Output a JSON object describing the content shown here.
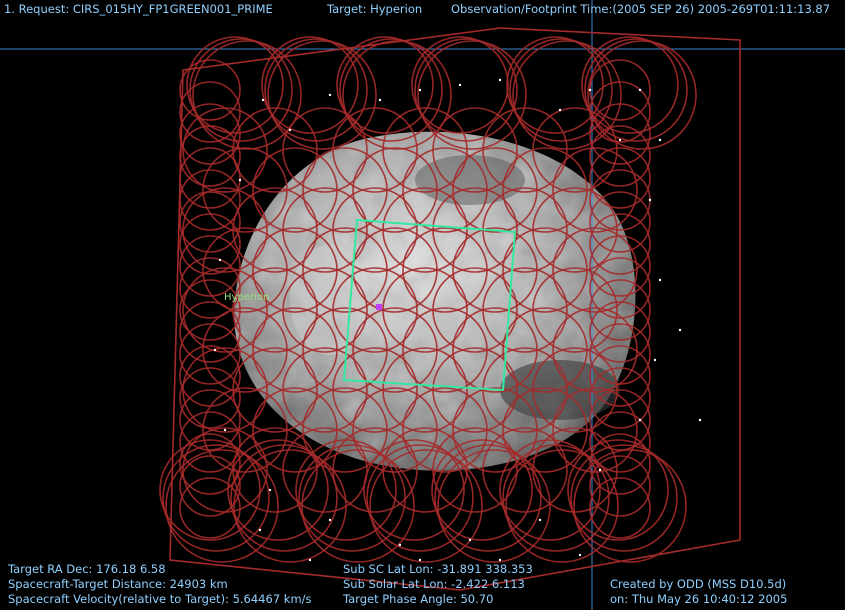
{
  "header": {
    "request": "1. Request: CIRS_015HY_FP1GREEN001_PRIME",
    "target": "Target: Hyperion",
    "observation_time": "Observation/Footprint Time:(2005 SEP 26) 2005-269T01:11:13.87"
  },
  "target_label": "Hyperion",
  "info_left": {
    "ra_dec": "Target RA Dec: 176.18   6.58",
    "distance": "Spacecraft-Target Distance:   24903 km",
    "velocity": "Spacecraft Velocity(relative to Target): 5.64467 km/s"
  },
  "info_center": {
    "sub_sc": "Sub SC Lat Lon: -31.891  338.353",
    "sub_solar": "Sub Solar Lat Lon: -2.422   6.113",
    "phase": "Target Phase Angle: 50.70"
  },
  "info_right": {
    "created_by": "Created by ODD (MSS D10.5d)",
    "created_on": "on: Thu May 26 10:40:12 2005"
  },
  "colors": {
    "footprint": "#a52a2a",
    "fov_box": "#33e8a0",
    "text": "#8fd0ff",
    "crosshair": "#3a8ad8",
    "boresight": "#c040ff"
  }
}
